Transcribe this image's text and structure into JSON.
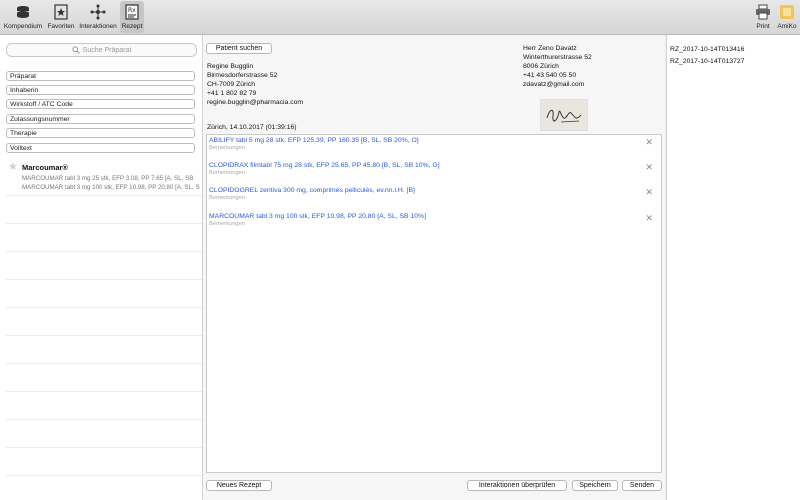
{
  "toolbar": {
    "left": [
      {
        "label": "Kompendium",
        "icon": "stack-icon"
      },
      {
        "label": "Favoriten",
        "icon": "star-doc-icon"
      },
      {
        "label": "Interaktionen",
        "icon": "graph-icon"
      },
      {
        "label": "Rezept",
        "icon": "prescription-icon"
      }
    ],
    "print_label": "Print",
    "amiko_label": "AmiKo"
  },
  "sidebar": {
    "search_placeholder": "Suche Präparat",
    "filters": [
      "Präparat",
      "Inhaberin",
      "Wirkstoff / ATC Code",
      "Zulassungsnummer",
      "Therapie",
      "Volltext"
    ],
    "result": {
      "title": "Marcoumar®",
      "lines": [
        "MARCOUMAR tabl 3 mg 25 stk, EFP 3.08, PP 7.65 [A, SL, SB",
        "MARCOUMAR tabl 3 mg 100 stk, EFP 10.98, PP 20.80 [A, SL, SB"
      ]
    }
  },
  "patient": {
    "search_button": "Patient suchen",
    "name": "Regine Bugglin",
    "street": "Birmesdorferstrasse 52",
    "city": "CH-7009 Zürich",
    "phone": "+41 1 802 82 79",
    "email": "regine.bugglin@pharmacia.com"
  },
  "doctor": {
    "name": "Herr Zeno Davatz",
    "street": "Winterthurerstrasse 52",
    "city": "8006 Zürich",
    "phone": "+41 43 540 05 50",
    "email": "zdavatz@gmail.com"
  },
  "date_line": "Zürich, 14.10.2017 (01:39:16)",
  "prescription": {
    "items": [
      {
        "title": "ABILIFY tabl 5 mg 28 stk, EFP 125.39, PP 160.35 [B, SL, SB 20%, O]",
        "note": "Bemerkungen"
      },
      {
        "title": "CLOPIDRAX filmtabl 75 mg 28 stk, EFP 25.65, PP 45.80 [B, SL, SB 10%, G]",
        "note": "Bemerkungen"
      },
      {
        "title": "CLOPIDOGREL zentiva 300 mg, comprimés pelliculés, ev.nn.i.H. [B]",
        "note": "Bemerkungen"
      },
      {
        "title": "MARCOUMAR tabl 3 mg 100 stk, EFP 10.98, PP 20.80 [A, SL, SB 10%]",
        "note": "Bemerkungen"
      }
    ]
  },
  "actions": {
    "new": "Neues Rezept",
    "check": "Interaktionen überprüfen",
    "save": "Speichern",
    "send": "Senden"
  },
  "saved_files": [
    "RZ_2017-10-14T013416",
    "RZ_2017-10-14T013727"
  ],
  "colors": {
    "link": "#2a5bd7",
    "note": "#a9a9a9"
  }
}
